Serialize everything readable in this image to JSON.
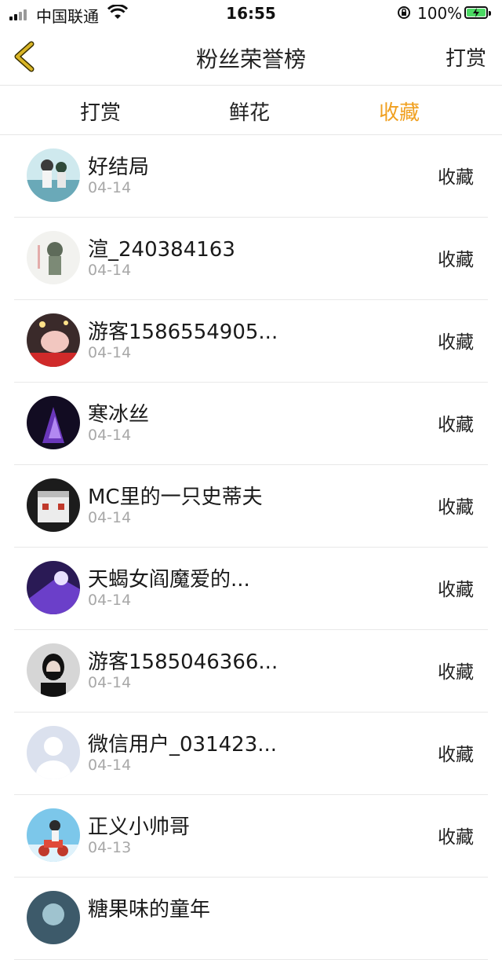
{
  "status": {
    "carrier": "中国联通",
    "time": "16:55",
    "battery": "100%"
  },
  "nav": {
    "title": "粉丝荣誉榜",
    "action": "打赏"
  },
  "tabs": [
    {
      "label": "打赏"
    },
    {
      "label": "鲜花"
    },
    {
      "label": "收藏"
    }
  ],
  "fans": [
    {
      "name": "好结局",
      "date": "04-14",
      "action": "收藏"
    },
    {
      "name": "渲_240384163",
      "date": "04-14",
      "action": "收藏"
    },
    {
      "name": "游客1586554905...",
      "date": "04-14",
      "action": "收藏"
    },
    {
      "name": "寒冰丝",
      "date": "04-14",
      "action": "收藏"
    },
    {
      "name": "MC里的一只史蒂夫",
      "date": "04-14",
      "action": "收藏"
    },
    {
      "name": "天蝎女阎魔爱的...",
      "date": "04-14",
      "action": "收藏"
    },
    {
      "name": "游客1585046366...",
      "date": "04-14",
      "action": "收藏"
    },
    {
      "name": "微信用户_031423...",
      "date": "04-14",
      "action": "收藏"
    },
    {
      "name": "正义小帅哥",
      "date": "04-13",
      "action": "收藏"
    },
    {
      "name": "糖果味的童年",
      "date": "",
      "action": ""
    }
  ],
  "colors": {
    "accent": "#f0a020",
    "back_arrow": "#d9b526",
    "battery": "#4cd964"
  }
}
